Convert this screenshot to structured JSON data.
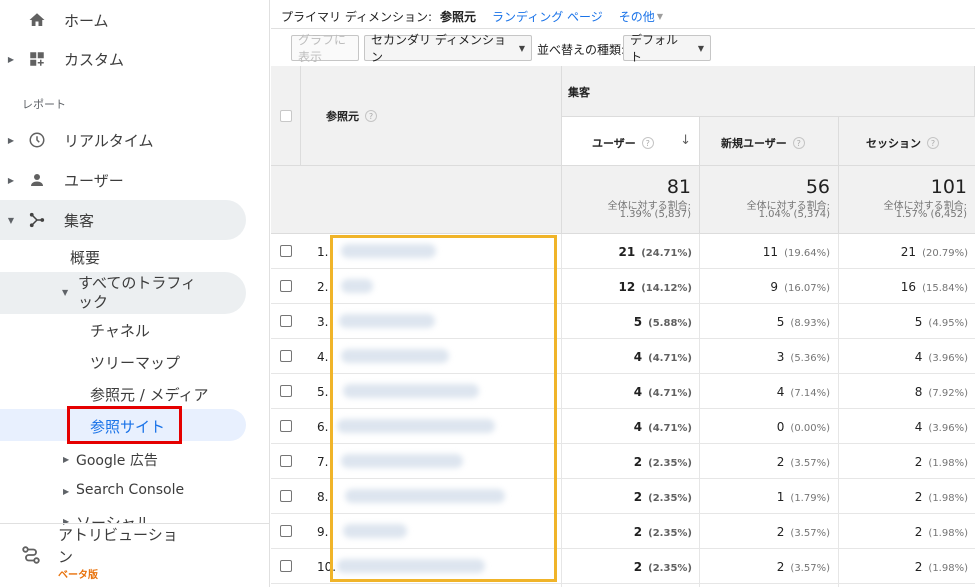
{
  "sidebar": {
    "home": "ホーム",
    "custom": "カスタム",
    "section_label": "レポート",
    "realtime": "リアルタイム",
    "users": "ユーザー",
    "acquisition": "集客",
    "overview": "概要",
    "all_traffic": "すべてのトラフィック",
    "channels": "チャネル",
    "treemap": "ツリーマップ",
    "source_medium": "参照元 / メディア",
    "referrals": "参照サイト",
    "google_ads": "Google 広告",
    "search_console": "Search Console",
    "social": "ソーシャル",
    "attribution": "アトリビューション",
    "beta": "ベータ版"
  },
  "primary_dimension": {
    "label": "プライマリ ディメンション:",
    "current": "参照元",
    "landing_page": "ランディング ページ",
    "other": "その他"
  },
  "toolbar": {
    "plot_rows": "グラフに表示",
    "secondary_dimension": "セカンダリ ディメンション",
    "sort_label": "並べ替えの種類:",
    "sort_value": "デフォルト"
  },
  "table": {
    "dim_header": "参照元",
    "group_header": "集客",
    "col_users": "ユーザー",
    "col_new_users": "新規ユーザー",
    "col_sessions": "セッション",
    "totals": {
      "share_label": "全体に対する割合:",
      "users": "81",
      "users_share": "1.39% (5,837)",
      "new_users": "56",
      "new_users_share": "1.04% (5,374)",
      "sessions": "101",
      "sessions_share": "1.57% (6,452)"
    },
    "rows": [
      {
        "n": "1.",
        "users": "21",
        "users_pct": "(24.71%)",
        "new": "11",
        "new_pct": "(19.64%)",
        "sess": "21",
        "sess_pct": "(20.79%)"
      },
      {
        "n": "2.",
        "users": "12",
        "users_pct": "(14.12%)",
        "new": "9",
        "new_pct": "(16.07%)",
        "sess": "16",
        "sess_pct": "(15.84%)"
      },
      {
        "n": "3.",
        "users": "5",
        "users_pct": "(5.88%)",
        "new": "5",
        "new_pct": "(8.93%)",
        "sess": "5",
        "sess_pct": "(4.95%)"
      },
      {
        "n": "4.",
        "users": "4",
        "users_pct": "(4.71%)",
        "new": "3",
        "new_pct": "(5.36%)",
        "sess": "4",
        "sess_pct": "(3.96%)"
      },
      {
        "n": "5.",
        "users": "4",
        "users_pct": "(4.71%)",
        "new": "4",
        "new_pct": "(7.14%)",
        "sess": "8",
        "sess_pct": "(7.92%)"
      },
      {
        "n": "6.",
        "users": "4",
        "users_pct": "(4.71%)",
        "new": "0",
        "new_pct": "(0.00%)",
        "sess": "4",
        "sess_pct": "(3.96%)"
      },
      {
        "n": "7.",
        "users": "2",
        "users_pct": "(2.35%)",
        "new": "2",
        "new_pct": "(3.57%)",
        "sess": "2",
        "sess_pct": "(1.98%)"
      },
      {
        "n": "8.",
        "users": "2",
        "users_pct": "(2.35%)",
        "new": "1",
        "new_pct": "(1.79%)",
        "sess": "2",
        "sess_pct": "(1.98%)"
      },
      {
        "n": "9.",
        "users": "2",
        "users_pct": "(2.35%)",
        "new": "2",
        "new_pct": "(3.57%)",
        "sess": "2",
        "sess_pct": "(1.98%)"
      },
      {
        "n": "10.",
        "users": "2",
        "users_pct": "(2.35%)",
        "new": "2",
        "new_pct": "(3.57%)",
        "sess": "2",
        "sess_pct": "(1.98%)"
      }
    ]
  },
  "colors": {
    "accent": "#1a73e8",
    "selection_box": "#e50000",
    "highlight_box": "#f0b429",
    "beta": "#e8710a"
  }
}
